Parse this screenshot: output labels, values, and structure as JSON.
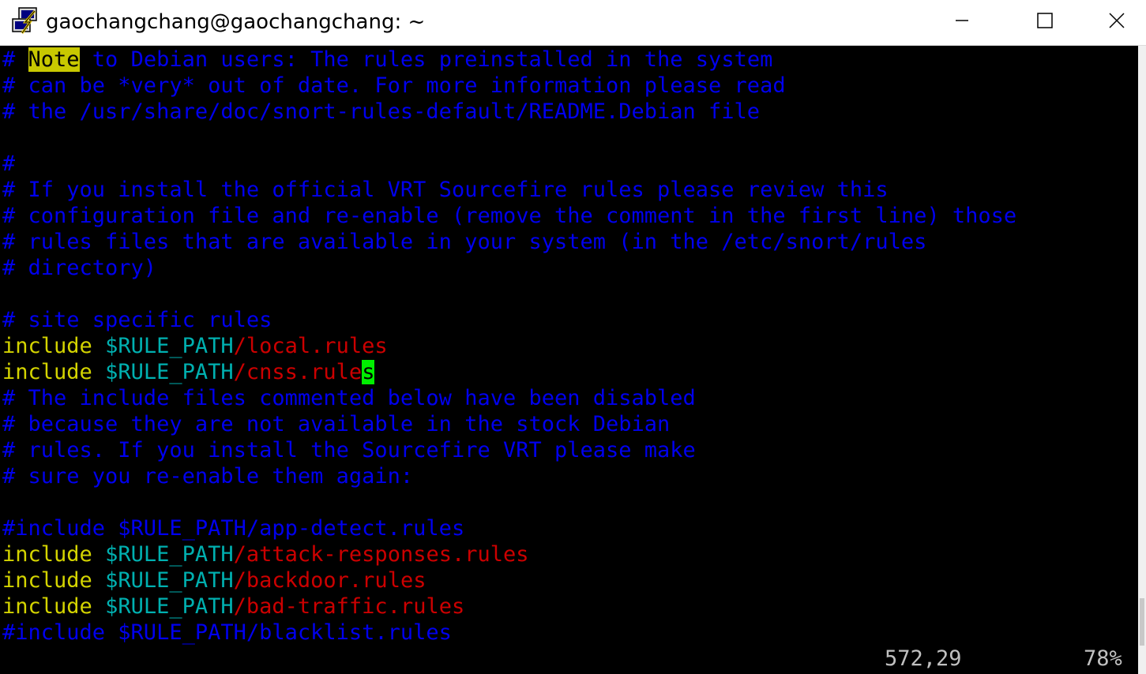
{
  "window": {
    "title": "gaochangchang@gaochangchang: ~",
    "icon": "putty-terminal-icon",
    "buttons": {
      "minimize": "minimize-icon",
      "maximize": "maximize-icon",
      "close": "close-icon"
    }
  },
  "colors": {
    "background": "#000000",
    "comment": "#0000ee",
    "keyword": "#d4d400",
    "variable": "#00b0b0",
    "path": "#cc0000",
    "cursor": "#00ee00",
    "search_highlight": "#c8c800",
    "status_text": "#c0c0c0"
  },
  "editor": {
    "lines": [
      {
        "type": "note",
        "hash": "# ",
        "highlight": "Note",
        "rest": " to Debian users: The rules preinstalled in the system"
      },
      {
        "type": "comment",
        "text": "# can be *very* out of date. For more information please read"
      },
      {
        "type": "comment",
        "text": "# the /usr/share/doc/snort-rules-default/README.Debian file"
      },
      {
        "type": "blank",
        "text": ""
      },
      {
        "type": "comment",
        "text": "#"
      },
      {
        "type": "comment",
        "text": "# If you install the official VRT Sourcefire rules please review this"
      },
      {
        "type": "comment",
        "text": "# configuration file and re-enable (remove the comment in the first line) those"
      },
      {
        "type": "comment",
        "text": "# rules files that are available in your system (in the /etc/snort/rules"
      },
      {
        "type": "comment",
        "text": "# directory)"
      },
      {
        "type": "blank",
        "text": ""
      },
      {
        "type": "comment",
        "text": "# site specific rules"
      },
      {
        "type": "include",
        "kw": "include",
        "var": "$RULE_PATH",
        "path": "/local.rules"
      },
      {
        "type": "include-cursor",
        "kw": "include",
        "var": "$RULE_PATH",
        "path": "/cnss.rule",
        "cursor": "s"
      },
      {
        "type": "comment",
        "text": "# The include files commented below have been disabled"
      },
      {
        "type": "comment",
        "text": "# because they are not available in the stock Debian"
      },
      {
        "type": "comment",
        "text": "# rules. If you install the Sourcefire VRT please make"
      },
      {
        "type": "comment",
        "text": "# sure you re-enable them again:"
      },
      {
        "type": "blank",
        "text": ""
      },
      {
        "type": "comment",
        "text": "#include $RULE_PATH/app-detect.rules"
      },
      {
        "type": "include",
        "kw": "include",
        "var": "$RULE_PATH",
        "path": "/attack-responses.rules"
      },
      {
        "type": "include",
        "kw": "include",
        "var": "$RULE_PATH",
        "path": "/backdoor.rules"
      },
      {
        "type": "include",
        "kw": "include",
        "var": "$RULE_PATH",
        "path": "/bad-traffic.rules"
      },
      {
        "type": "comment",
        "text": "#include $RULE_PATH/blacklist.rules"
      }
    ],
    "status": {
      "position": "572,29",
      "percent": "78%"
    }
  }
}
